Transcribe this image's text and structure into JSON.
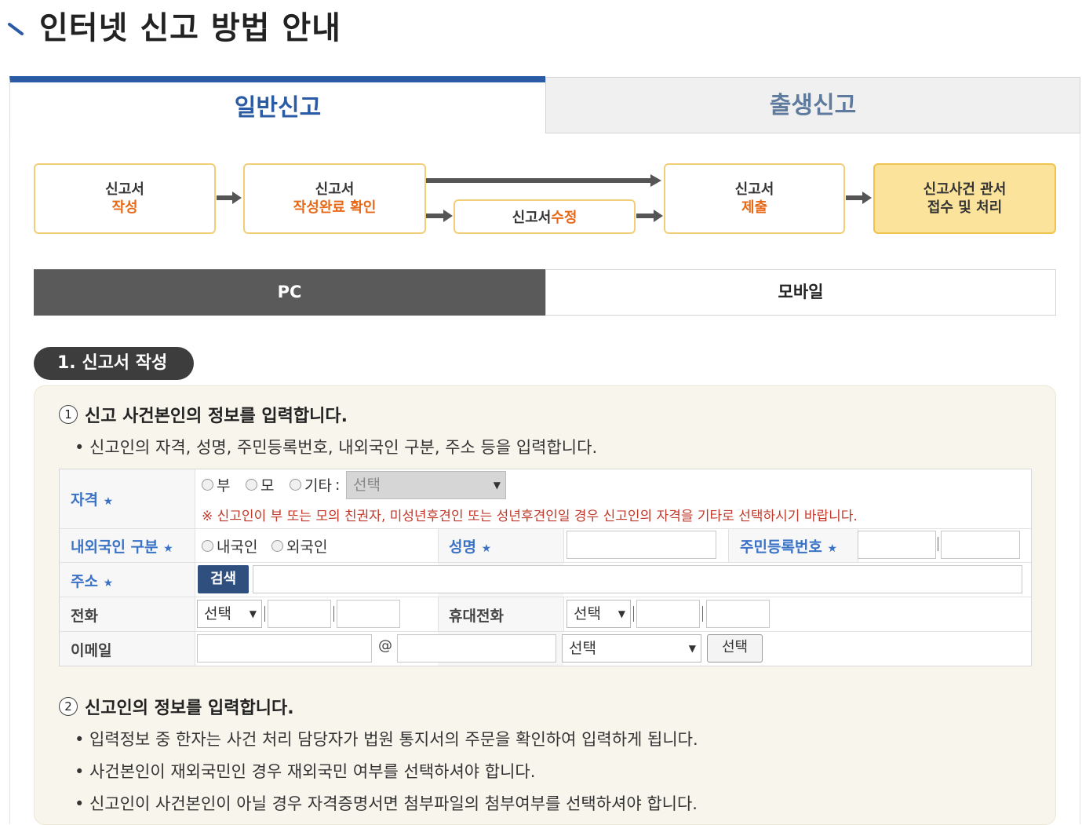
{
  "page": {
    "title": "인터넷 신고 방법 안내"
  },
  "tabs": [
    {
      "label": "일반신고",
      "active": true
    },
    {
      "label": "출생신고",
      "active": false
    }
  ],
  "flow": {
    "step1": {
      "line1": "신고서",
      "line2": "작성"
    },
    "step2": {
      "line1": "신고서",
      "line2": "작성완료 확인"
    },
    "step3": {
      "prefix": "신고서",
      "accent": "수정"
    },
    "step4": {
      "line1": "신고서",
      "line2": "제출"
    },
    "step5": {
      "line1": "신고사건 관서",
      "line2": "접수 및 처리"
    }
  },
  "device_tabs": [
    {
      "label": "PC",
      "active": true
    },
    {
      "label": "모바일",
      "active": false
    }
  ],
  "section": {
    "label": "1. 신고서 작성"
  },
  "steps": [
    {
      "number": "1",
      "title": "신고 사건본인의 정보를 입력합니다.",
      "bullets": [
        "• 신고인의 자격, 성명, 주민등록번호, 내외국인 구분, 주소 등을 입력합니다."
      ]
    },
    {
      "number": "2",
      "title": "신고인의 정보를 입력합니다.",
      "bullets": [
        "• 입력정보 중 한자는 사건 처리 담당자가 법원 통지서의 주문을 확인하여 입력하게 됩니다.",
        "• 사건본인이 재외국민인 경우 재외국민 여부를 선택하셔야 합니다.",
        "• 신고인이 사건본인이 아닐 경우 자격증명서면 첨부파일의 첨부여부를 선택하셔야 합니다."
      ]
    }
  ],
  "form": {
    "required_mark": "★",
    "qualification": {
      "label": "자격",
      "options": [
        "부",
        "모",
        "기타"
      ],
      "colon": ":",
      "select_value": "선택",
      "notice": "※ 신고인이 부 또는 모의 친권자, 미성년후견인 또는 성년후견인일 경우 신고인의 자격을 기타로 선택하시기 바랍니다."
    },
    "nationality": {
      "label": "내외국인 구분",
      "options": [
        "내국인",
        "외국인"
      ]
    },
    "name": {
      "label": "성명"
    },
    "rrn": {
      "label": "주민등록번호"
    },
    "address": {
      "label": "주소",
      "search_button": "검색"
    },
    "phone": {
      "label": "전화",
      "select_value": "선택"
    },
    "mobile": {
      "label": "휴대전화",
      "select_value": "선택"
    },
    "email": {
      "label": "이메일",
      "at": "@",
      "select_value": "선택",
      "choose_button": "선택"
    }
  },
  "colors": {
    "accent_blue": "#2c5ba6",
    "step_border": "#f3ce79",
    "step_accent": "#e66a1a",
    "step_final_bg": "#fbe39b",
    "notice_red": "#c0392b",
    "label_blue": "#3a72c6"
  },
  "icons": {
    "title_mark": "diagonal-stroke-icon",
    "arrow": "arrow-right-icon",
    "select_caret": "caret-down-icon"
  }
}
